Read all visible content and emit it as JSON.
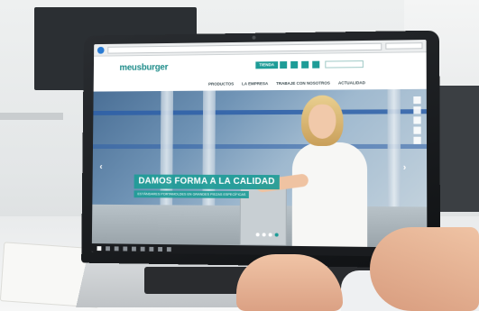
{
  "scene": {
    "description_colors": {
      "brand_teal": "#1e9c97",
      "browser_blue": "#2a7bd3"
    }
  },
  "website": {
    "brand_logo": "meusburger",
    "shop_button": "TIENDA",
    "nav": [
      "PRODUCTOS",
      "LA EMPRESA",
      "TRABAJE CON NOSOTROS",
      "ACTUALIDAD"
    ],
    "hero_title": "DAMOS FORMA A LA CALIDAD",
    "hero_subtitle": "ESTÁNDARES PORTAMOLDES EN GRANDES PIEZAS ESPECÍFICAS"
  }
}
